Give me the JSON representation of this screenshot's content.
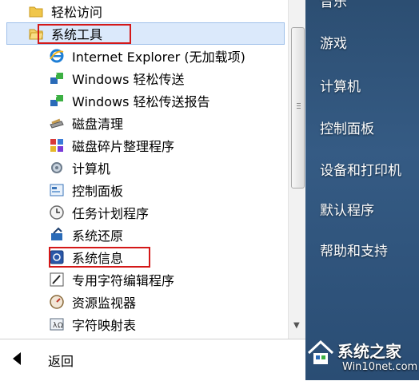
{
  "start_menu": {
    "folders": [
      {
        "label": "轻松访问",
        "icon": "folder-icon"
      },
      {
        "label": "系统工具",
        "icon": "folder-icon"
      }
    ],
    "items": [
      {
        "label": "Internet Explorer (无加载项)",
        "icon": "internet-explorer-icon"
      },
      {
        "label": "Windows 轻松传送",
        "icon": "easy-transfer-icon"
      },
      {
        "label": "Windows 轻松传送报告",
        "icon": "easy-transfer-report-icon"
      },
      {
        "label": "磁盘清理",
        "icon": "disk-cleanup-icon"
      },
      {
        "label": "磁盘碎片整理程序",
        "icon": "defragmenter-icon"
      },
      {
        "label": "计算机",
        "icon": "computer-icon"
      },
      {
        "label": "控制面板",
        "icon": "control-panel-icon"
      },
      {
        "label": "任务计划程序",
        "icon": "task-scheduler-icon"
      },
      {
        "label": "系统还原",
        "icon": "system-restore-icon"
      },
      {
        "label": "系统信息",
        "icon": "system-info-icon"
      },
      {
        "label": "专用字符编辑程序",
        "icon": "private-char-editor-icon"
      },
      {
        "label": "资源监视器",
        "icon": "resource-monitor-icon"
      },
      {
        "label": "字符映射表",
        "icon": "character-map-icon"
      }
    ],
    "back_label": "返回",
    "highlight_color": "#d41818"
  },
  "right_panel": {
    "items": [
      "音乐",
      "游戏",
      "计算机",
      "控制面板",
      "设备和打印机",
      "默认程序",
      "帮助和支持"
    ]
  },
  "watermark": {
    "title": "系统之家",
    "url": "Win10net.com"
  }
}
